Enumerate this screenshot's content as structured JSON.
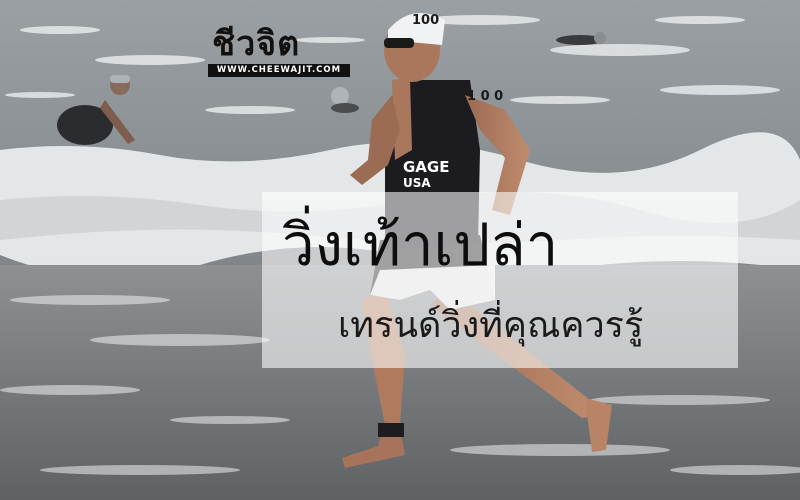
{
  "logo": {
    "name": "ชีวจิต",
    "url": "WWW.CHEEWAJIT.COM"
  },
  "cap_number": "100",
  "arm_number": "1 0 0",
  "bib_name": "GAGE",
  "bib_country": "USA",
  "headline": {
    "title": "วิ่งเท้าเปล่า",
    "subtitle": "เทรนด์วิ่งที่คุณควรรู้"
  },
  "colors": {
    "sea": "#8f9497",
    "foam": "#eef1f2",
    "wet_sand": "#6f7274",
    "suit": "#1c1c20"
  }
}
